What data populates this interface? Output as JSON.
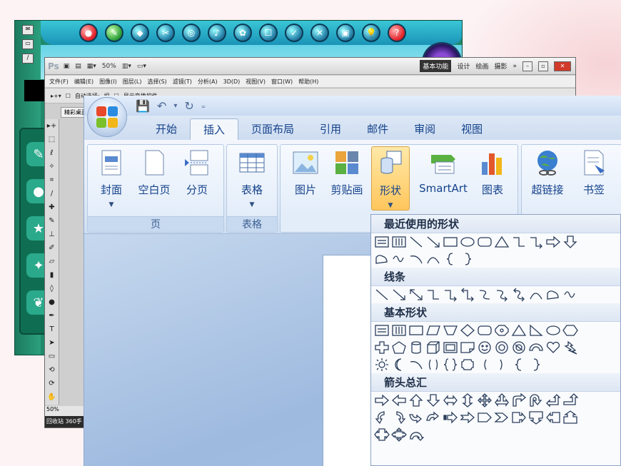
{
  "photoshop": {
    "logo": "Ps",
    "zoom": "50%",
    "workspaces": [
      "基本功能",
      "设计",
      "绘画",
      "摄影"
    ],
    "more": "»",
    "menus": [
      "文件(F)",
      "编辑(E)",
      "图像(I)",
      "图层(L)",
      "选择(S)",
      "滤镜(T)",
      "分析(A)",
      "3D(D)",
      "视图(V)",
      "窗口(W)",
      "帮助(H)"
    ],
    "options": [
      "自动选择:",
      "组",
      "显示变换控件"
    ],
    "doc_tab": "精彩桌面",
    "status_zoom": "50%",
    "taskbar": "回收站 360手"
  },
  "word": {
    "tabs": [
      "开始",
      "插入",
      "页面布局",
      "引用",
      "邮件",
      "审阅",
      "视图"
    ],
    "active_tab": "插入",
    "groups": [
      {
        "label": "页",
        "buttons": [
          "封面",
          "空白页",
          "分页"
        ]
      },
      {
        "label": "表格",
        "buttons": [
          "表格"
        ]
      },
      {
        "label": "",
        "buttons": [
          "图片",
          "剪贴画",
          "形状",
          "SmartArt",
          "图表"
        ]
      },
      {
        "label": "",
        "buttons": [
          "超链接",
          "书签"
        ]
      }
    ]
  },
  "shapes_menu": {
    "sections": [
      "最近使用的形状",
      "线条",
      "基本形状",
      "箭头总汇"
    ]
  },
  "colors": {
    "word_tab_text": "#15428b",
    "ribbon_active": "#ffc65c",
    "kids_green": "#1f8a6b"
  }
}
